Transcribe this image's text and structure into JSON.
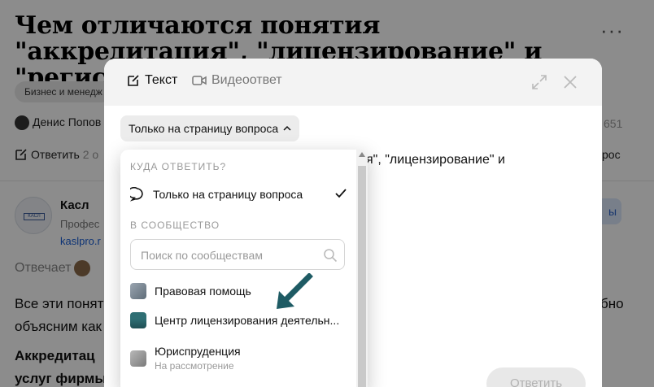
{
  "page": {
    "question_title": "Чем отличаются понятия \"аккредитация\", \"лицензирование\" и \"регистрация\"?",
    "tag": "Бизнес и менедж",
    "author": "Денис Попов",
    "views_fragment": "651",
    "answer_action": "Ответить",
    "answer_action_extra": "2 о",
    "right_fragment": "рос",
    "org": {
      "name": "Касл",
      "logo_text": "КАСЛ",
      "description": "Профес",
      "link": "kaslpro.r",
      "subscribe_fragment": "ы"
    },
    "answers_by": "Отвечает",
    "body_line1": "Все эти понят",
    "body_line2": "объясним как",
    "body_tail": "бно",
    "bold_line1": "Аккредитац",
    "bold_line2": "услуг фирмы"
  },
  "modal": {
    "tab_text": "Текст",
    "tab_video": "Видеоответ",
    "scope_button": "Только на страницу вопроса",
    "editor_line1": "я\", \"лицензирование\" и",
    "editor_colon": ":",
    "submit": "Ответить"
  },
  "dropdown": {
    "section_where": "КУДА ОТВЕТИТЬ?",
    "option_page": "Только на страницу вопроса",
    "section_community": "В СООБЩЕСТВО",
    "search_placeholder": "Поиск по сообществам",
    "communities": [
      {
        "label": "Правовая помощь"
      },
      {
        "label": "Центр лицензирования деятельн..."
      },
      {
        "label": "Юриспруденция",
        "sub": "На рассмотрение"
      }
    ]
  },
  "colors": {
    "overlay": "#00000073",
    "pointer_arrow": "#1e5b64",
    "link": "#1a5fd6"
  }
}
